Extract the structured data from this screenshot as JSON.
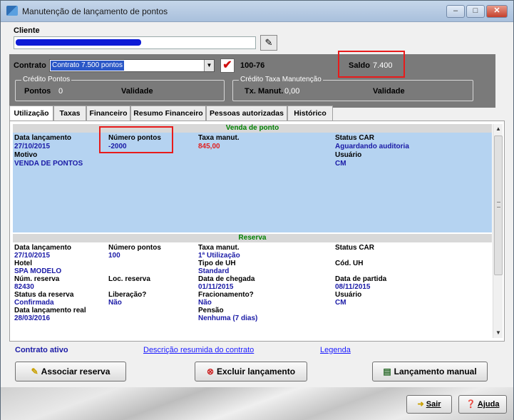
{
  "window": {
    "title": "Manutenção de lançamento de pontos",
    "min": "–",
    "max": "□",
    "close": "✕"
  },
  "cliente": {
    "label": "Cliente",
    "value": ""
  },
  "contrato": {
    "label": "Contrato",
    "selected": "Contrato 7.500 pontos",
    "code": "100-76",
    "check": "✔"
  },
  "saldo": {
    "label": "Saldo",
    "value": "7.400"
  },
  "credito_pontos": {
    "title": "Crédito Pontos",
    "pontos_label": "Pontos",
    "pontos_value": "0",
    "validade_label": "Validade"
  },
  "credito_taxa": {
    "title": "Crédito Taxa Manutenção",
    "tx_label": "Tx. Manut.",
    "tx_value": "0,00",
    "validade_label": "Validade"
  },
  "tabs": [
    "Utilização",
    "Taxas",
    "Financeiro",
    "Resumo Financeiro",
    "Pessoas autorizadas",
    "Histórico"
  ],
  "venda": {
    "header": "Venda de ponto",
    "data_lancamento_label": "Data lançamento",
    "data_lancamento": "27/10/2015",
    "numero_pontos_label": "Número pontos",
    "numero_pontos": "-2000",
    "taxa_manut_label": "Taxa manut.",
    "taxa_manut": "845,00",
    "status_car_label": "Status CAR",
    "status_car": "Aguardando auditoria",
    "motivo_label": "Motivo",
    "motivo": "VENDA DE PONTOS",
    "usuario_label": "Usuário",
    "usuario": "CM"
  },
  "reserva": {
    "header": "Reserva",
    "data_lancamento_label": "Data lançamento",
    "data_lancamento": "27/10/2015",
    "numero_pontos_label": "Número pontos",
    "numero_pontos": "100",
    "taxa_manut_label": "Taxa manut.",
    "taxa_manut": "1ª Utilização",
    "status_car_label": "Status CAR",
    "hotel_label": "Hotel",
    "hotel": "SPA MODELO",
    "tipo_uh_label": "Tipo de UH",
    "tipo_uh": "Standard",
    "cod_uh_label": "Cód. UH",
    "num_reserva_label": "Núm. reserva",
    "num_reserva": "82430",
    "loc_reserva_label": "Loc. reserva",
    "data_chegada_label": "Data de chegada",
    "data_chegada": "01/11/2015",
    "data_partida_label": "Data de partida",
    "data_partida": "08/11/2015",
    "status_reserva_label": "Status da reserva",
    "status_reserva": "Confirmada",
    "liberacao_label": "Liberação?",
    "liberacao": "Não",
    "fracionamento_label": "Fracionamento?",
    "fracionamento": "Não",
    "usuario_label": "Usuário",
    "usuario": "CM",
    "data_real_label": "Data lançamento real",
    "data_real": "28/03/2016",
    "pensao_label": "Pensão",
    "pensao": "Nenhuma (7 dias)"
  },
  "bottom": {
    "status": "Contrato ativo",
    "descricao_link": "Descrição resumida do contrato",
    "legenda_link": "Legenda"
  },
  "buttons": {
    "associar": "Associar reserva",
    "excluir": "Excluir lançamento",
    "manual": "Lançamento manual"
  },
  "footer": {
    "sair": "Sair",
    "ajuda": "Ajuda"
  }
}
